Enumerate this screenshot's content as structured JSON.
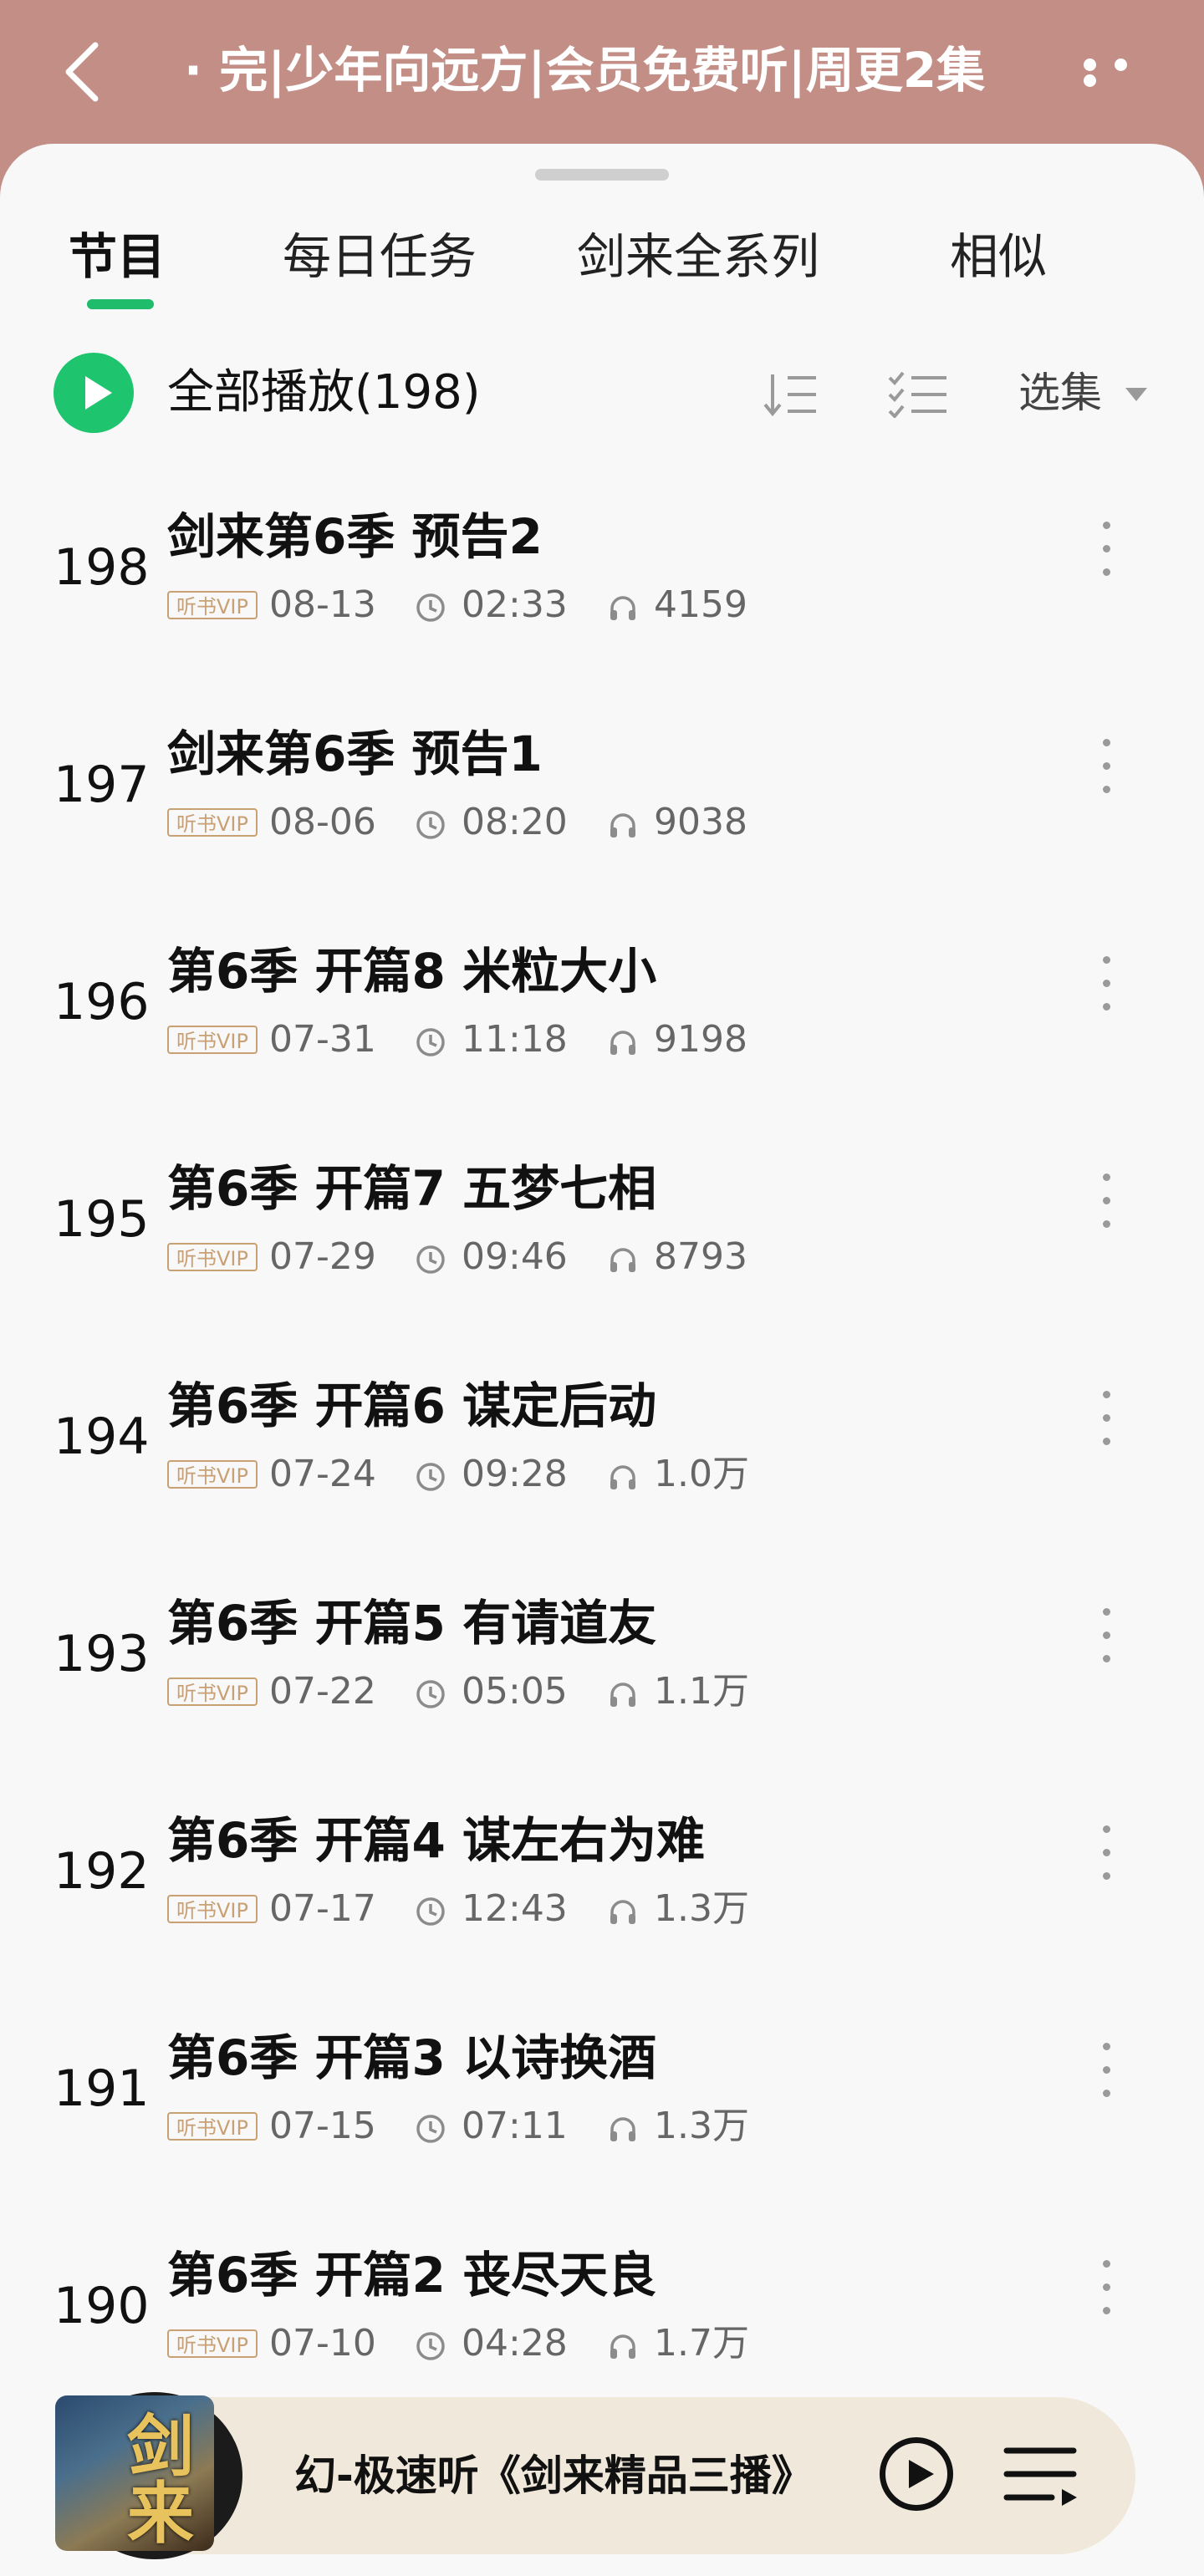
{
  "header": {
    "title": "· 完|少年向远方|会员免费听|周更2集"
  },
  "tabs": [
    {
      "label": "节目",
      "active": true
    },
    {
      "label": "每日任务",
      "active": false
    },
    {
      "label": "剑来全系列",
      "active": false
    },
    {
      "label": "相似",
      "active": false
    }
  ],
  "controls": {
    "play_all": "全部播放(198)",
    "choose": "选集"
  },
  "episodes": [
    {
      "num": "198",
      "title": "剑来第6季 预告2",
      "badge": "听书VIP",
      "date": "08-13",
      "duration": "02:33",
      "plays": "4159"
    },
    {
      "num": "197",
      "title": "剑来第6季 预告1",
      "badge": "听书VIP",
      "date": "08-06",
      "duration": "08:20",
      "plays": "9038"
    },
    {
      "num": "196",
      "title": "第6季 开篇8 米粒大小",
      "badge": "听书VIP",
      "date": "07-31",
      "duration": "11:18",
      "plays": "9198"
    },
    {
      "num": "195",
      "title": "第6季 开篇7 五梦七相",
      "badge": "听书VIP",
      "date": "07-29",
      "duration": "09:46",
      "plays": "8793"
    },
    {
      "num": "194",
      "title": "第6季 开篇6 谋定后动",
      "badge": "听书VIP",
      "date": "07-24",
      "duration": "09:28",
      "plays": "1.0万"
    },
    {
      "num": "193",
      "title": "第6季 开篇5 有请道友",
      "badge": "听书VIP",
      "date": "07-22",
      "duration": "05:05",
      "plays": "1.1万"
    },
    {
      "num": "192",
      "title": "第6季 开篇4 谋左右为难",
      "badge": "听书VIP",
      "date": "07-17",
      "duration": "12:43",
      "plays": "1.3万"
    },
    {
      "num": "191",
      "title": "第6季 开篇3 以诗换酒",
      "badge": "听书VIP",
      "date": "07-15",
      "duration": "07:11",
      "plays": "1.3万"
    },
    {
      "num": "190",
      "title": "第6季 开篇2 丧尽天良",
      "badge": "听书VIP",
      "date": "07-10",
      "duration": "04:28",
      "plays": "1.7万"
    }
  ],
  "player": {
    "title": "幻-极速听《剑来精品三播》",
    "cover_text": "剑来"
  },
  "colors": {
    "header_bg": "#c28e86",
    "accent_green": "#1fbc6b",
    "vip_gold": "#c9a074",
    "player_bg": "#f0e8da"
  }
}
